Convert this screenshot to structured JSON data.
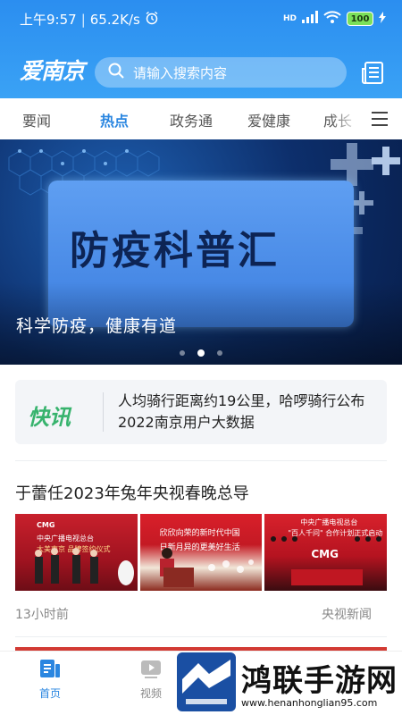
{
  "status_bar": {
    "time": "上午9:57",
    "speed": "65.2K/s",
    "network": "HD",
    "battery": "100"
  },
  "app": {
    "logo": "爱南京"
  },
  "search": {
    "placeholder": "请输入搜索内容"
  },
  "tabs": [
    {
      "label": "要闻",
      "active": false
    },
    {
      "label": "热点",
      "active": true
    },
    {
      "label": "政务通",
      "active": false
    },
    {
      "label": "爱健康",
      "active": false
    },
    {
      "label": "成长",
      "active": false
    }
  ],
  "banner": {
    "title": "防疫科普汇",
    "caption": "科学防疫，健康有道",
    "dots": 3,
    "active_dot": 2
  },
  "flash_news": {
    "badge": "快讯",
    "text": "人均骑行距离约19公里，哈啰骑行公布2022南京用户大数据"
  },
  "article": {
    "title": "于蕾任2023年兔年央视春晚总导",
    "time": "13小时前",
    "source": "央视新闻",
    "images": [
      {
        "caption_lines": [
          "CMG",
          "中央广播电视总台",
          "大美南京 品牌签约仪式"
        ]
      },
      {
        "caption_lines": [
          "欣欣向荣的新时代中国",
          "日新月异的更美好生活"
        ]
      },
      {
        "caption_lines": [
          "中央广播电视总台",
          "\"百人千问\" 合作计划正式启动",
          "CMG"
        ]
      }
    ]
  },
  "bottom_nav": [
    {
      "label": "首页",
      "active": true
    },
    {
      "label": "视频",
      "active": false
    }
  ],
  "watermark": {
    "text": "鸿联手游网",
    "url": "www.henanhonglian95.com"
  },
  "colors": {
    "primary": "#2b8ef0",
    "active_tab": "#2a86e0",
    "flash_green": "#37b36d"
  }
}
